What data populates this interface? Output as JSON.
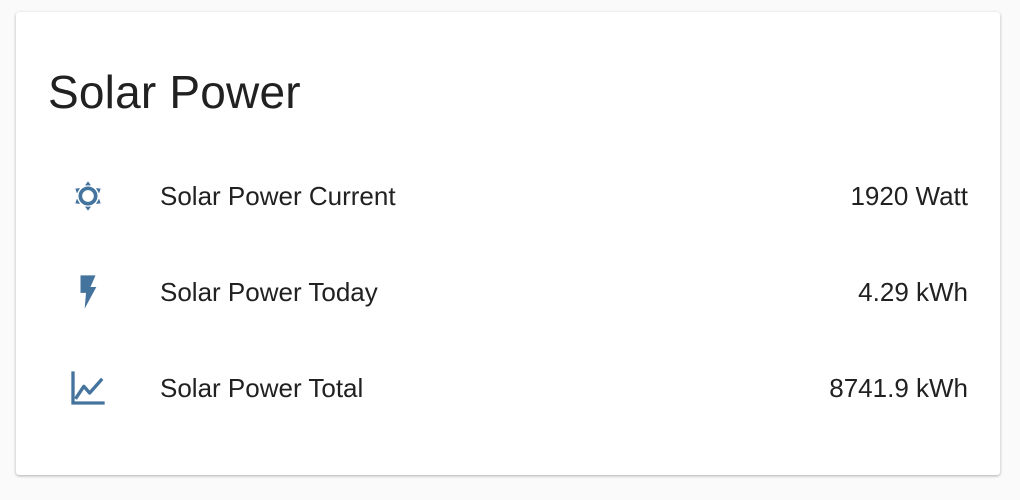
{
  "card": {
    "title": "Solar Power"
  },
  "colors": {
    "icon": "#44739e",
    "text": "#212121",
    "card_background": "#ffffff",
    "page_background": "#fafafa"
  },
  "entities": [
    {
      "name": "Solar Power Current",
      "state": "1920 Watt",
      "icon": "white-balance-sunny-icon"
    },
    {
      "name": "Solar Power Today",
      "state": "4.29 kWh",
      "icon": "flash-icon"
    },
    {
      "name": "Solar Power Total",
      "state": "8741.9 kWh",
      "icon": "chart-line-icon"
    }
  ]
}
